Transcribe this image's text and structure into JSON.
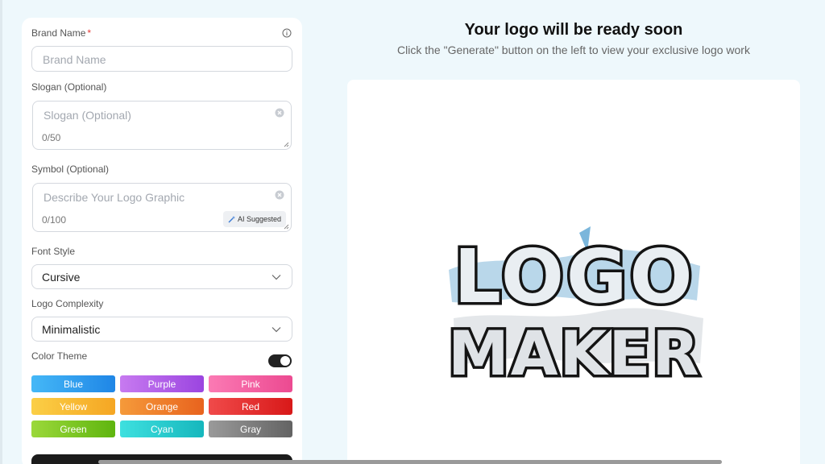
{
  "form": {
    "brand_name": {
      "label": "Brand Name",
      "required_mark": "*",
      "placeholder": "Brand Name"
    },
    "slogan": {
      "label": "Slogan (Optional)",
      "placeholder": "Slogan (Optional)",
      "count": "0/50"
    },
    "symbol": {
      "label": "Symbol (Optional)",
      "placeholder": "Describe Your Logo Graphic",
      "count": "0/100",
      "ai_button": "AI Suggested"
    },
    "font_style": {
      "label": "Font Style",
      "value": "Cursive"
    },
    "complexity": {
      "label": "Logo Complexity",
      "value": "Minimalistic"
    },
    "color_theme": {
      "label": "Color Theme",
      "toggle_on": true,
      "options": [
        {
          "label": "Blue",
          "color": "#2a9df4"
        },
        {
          "label": "Purple",
          "color": "#b35ae8"
        },
        {
          "label": "Pink",
          "color": "#f25aa0"
        },
        {
          "label": "Yellow",
          "color": "#f5b92e"
        },
        {
          "label": "Orange",
          "color": "#f07a26"
        },
        {
          "label": "Red",
          "color": "#e52a2a"
        },
        {
          "label": "Green",
          "color": "#7ac91e"
        },
        {
          "label": "Cyan",
          "color": "#22c9c9"
        },
        {
          "label": "Gray",
          "color": "#7a7a7a"
        }
      ]
    }
  },
  "main": {
    "title": "Your logo will be ready soon",
    "subtitle": "Click the \"Generate\" button on the left to view your exclusive logo work",
    "preview_logo": {
      "line1": "LOGO",
      "line2": "MAKER"
    }
  }
}
